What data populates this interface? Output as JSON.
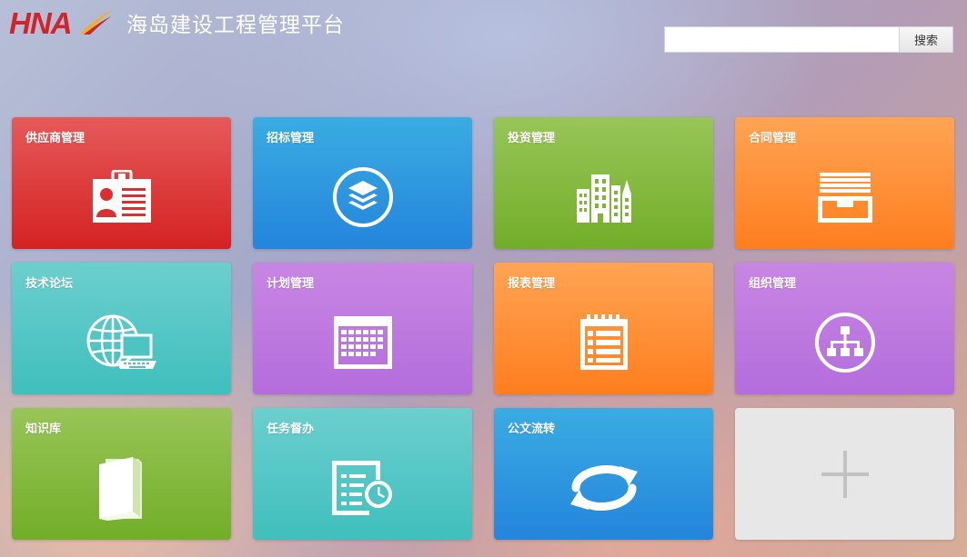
{
  "header": {
    "logo_text": "HNA",
    "title": "海岛建设工程管理平台"
  },
  "search": {
    "value": "",
    "placeholder": "",
    "button_label": "搜索"
  },
  "tiles": [
    {
      "label": "供应商管理",
      "icon": "id-card-icon",
      "color": "#dc3030"
    },
    {
      "label": "招标管理",
      "icon": "layers-icon",
      "color": "#2a8fde"
    },
    {
      "label": "投资管理",
      "icon": "buildings-icon",
      "color": "#80b534"
    },
    {
      "label": "合同管理",
      "icon": "file-drawer-icon",
      "color": "#ff8a2a"
    },
    {
      "label": "技术论坛",
      "icon": "globe-laptop-icon",
      "color": "#4dc3c2"
    },
    {
      "label": "计划管理",
      "icon": "calendar-icon",
      "color": "#bd78df"
    },
    {
      "label": "报表管理",
      "icon": "report-list-icon",
      "color": "#ff8a2a"
    },
    {
      "label": "组织管理",
      "icon": "org-chart-icon",
      "color": "#bd78df"
    },
    {
      "label": "知识库",
      "icon": "book-icon",
      "color": "#80b534"
    },
    {
      "label": "任务督办",
      "icon": "task-clock-icon",
      "color": "#4dc3c2"
    },
    {
      "label": "公文流转",
      "icon": "refresh-cycle-icon",
      "color": "#2a8fde"
    },
    {
      "label": "",
      "icon": "plus-icon",
      "color": "#e7e7e7"
    }
  ]
}
